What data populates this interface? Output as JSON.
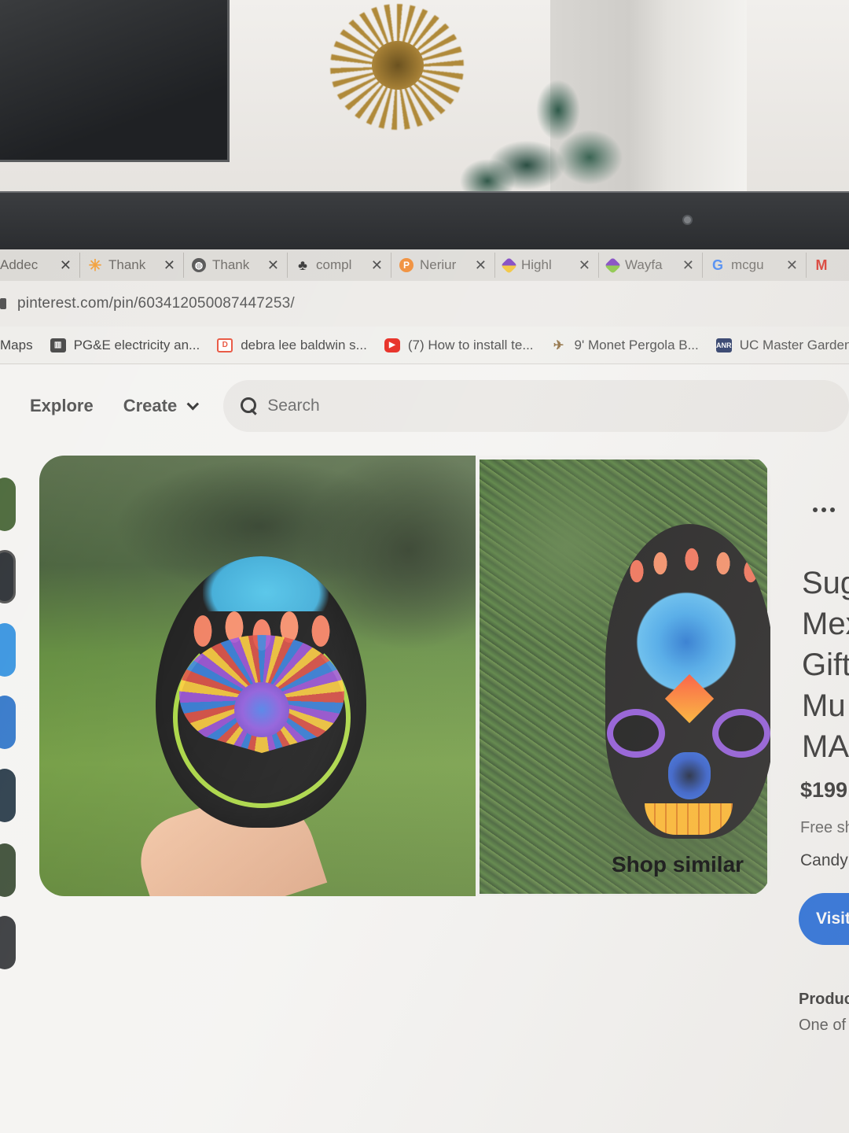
{
  "browser": {
    "tabs": [
      {
        "label": "Addec",
        "icon": "document-icon",
        "color": "#f2b84b"
      },
      {
        "label": "Thank",
        "icon": "sparkle-icon",
        "color": "#f3a23f"
      },
      {
        "label": "Thank",
        "icon": "globe-icon",
        "color": "#555555"
      },
      {
        "label": "compl",
        "icon": "tree-icon",
        "color": "#333333"
      },
      {
        "label": "Neriur",
        "icon": "heart-p-icon",
        "color": "#f08a32"
      },
      {
        "label": "Highl",
        "icon": "wayfair-icon",
        "color": "#7b3fbf"
      },
      {
        "label": "Wayfa",
        "icon": "wayfair-icon",
        "color": "#7b3fbf"
      },
      {
        "label": "mcgu",
        "icon": "google-icon",
        "color": "#4285f4"
      },
      {
        "label": "M",
        "icon": "gmail-icon",
        "color": "#d93025"
      }
    ],
    "tab_close": "✕",
    "url": "pinterest.com/pin/603412050087447253/",
    "bookmarks": [
      {
        "label": "Maps",
        "icon": "",
        "color": "#777777"
      },
      {
        "label": "PG&E electricity an...",
        "icon": "pge-icon",
        "color": "#4a4a4a"
      },
      {
        "label": "debra lee baldwin s...",
        "icon": "dlb-icon",
        "color": "#e8523c"
      },
      {
        "label": "(7) How to install te...",
        "icon": "youtube-icon",
        "color": "#e62117"
      },
      {
        "label": "9' Monet Pergola B...",
        "icon": "bird-icon",
        "color": "#8b6a3a"
      },
      {
        "label": "UC Master Gardene...",
        "icon": "anr-icon",
        "color": "#1d2f5e"
      }
    ]
  },
  "header": {
    "explore": "Explore",
    "create": "Create",
    "search_placeholder": "Search"
  },
  "pin": {
    "more_label": "•••",
    "title_lines": [
      "Sug",
      "Mex",
      "Gift",
      "Mu",
      "MA"
    ],
    "price": "$199.",
    "shipping": "Free sh",
    "seller": "Candy",
    "visit_button": "Visit",
    "details_heading": "Produc",
    "details_text": "One of",
    "shop_similar": "Shop similar"
  },
  "colors": {
    "accent": "#1160d8",
    "screen_bg": "#f4f3f1"
  }
}
